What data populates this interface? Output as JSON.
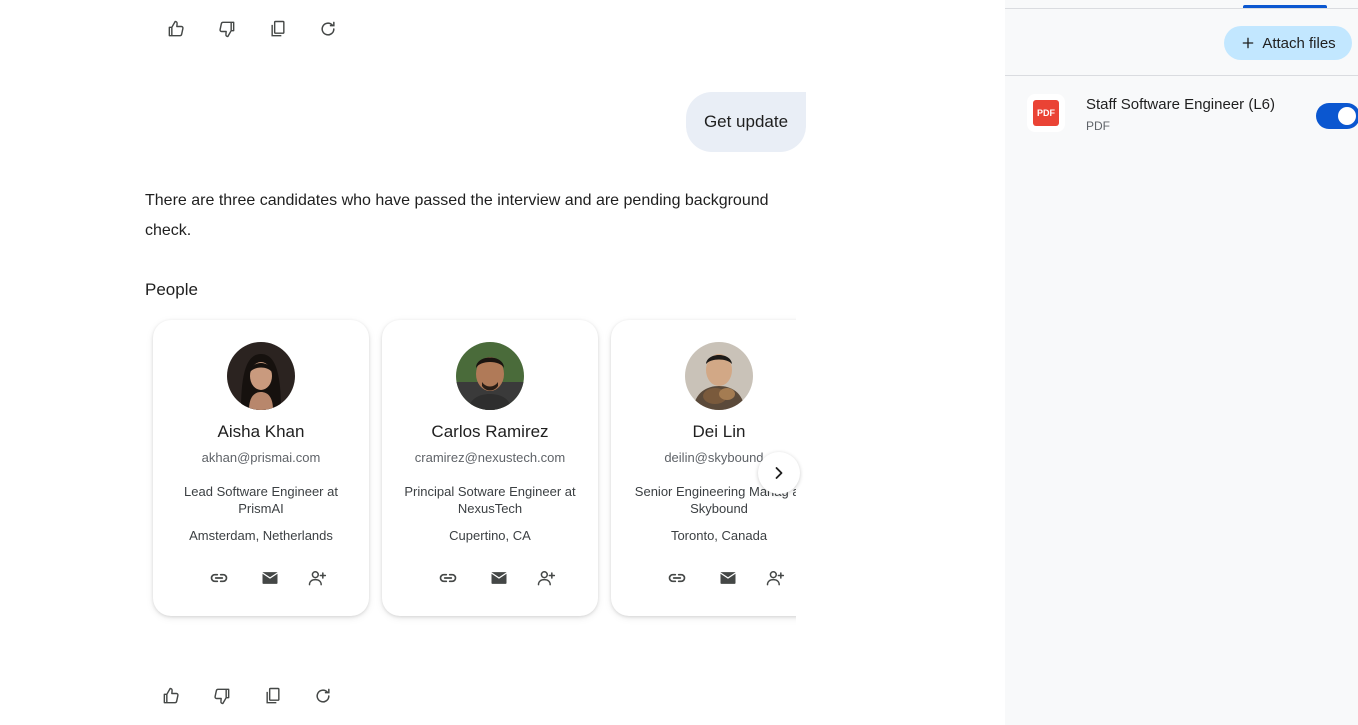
{
  "chat": {
    "user_message": "Get update",
    "response_text": "There are three candidates who have passed the interview and are pending background check.",
    "section_title": "People"
  },
  "people": [
    {
      "name": "Aisha Khan",
      "email": "akhan@prismai.com",
      "role": "Lead Software Engineer at PrismAI",
      "location": "Amsterdam, Netherlands"
    },
    {
      "name": "Carlos Ramirez",
      "email": "cramirez@nexustech.com",
      "role": "Principal Sotware Engineer at NexusTech",
      "location": "Cupertino, CA"
    },
    {
      "name": "Dei Lin",
      "email": "deilin@skybound.c",
      "role": "Senior Engineering Manag at Skybound",
      "location": "Toronto, Canada"
    }
  ],
  "card_actions": [
    "link-icon",
    "mail-icon",
    "add-contact-icon"
  ],
  "feedback_actions": [
    "thumbs-up-icon",
    "thumbs-down-icon",
    "copy-icon",
    "regenerate-icon"
  ],
  "side_panel": {
    "attach_label": "Attach files",
    "file": {
      "title": "Staff Software Engineer (L6)",
      "type": "PDF",
      "badge": "PDF",
      "enabled": true
    }
  },
  "colors": {
    "accent": "#0b57d0",
    "attach_bg": "#c2e7ff",
    "pdf_red": "#ea4335",
    "bubble_bg": "#e9eef6"
  }
}
